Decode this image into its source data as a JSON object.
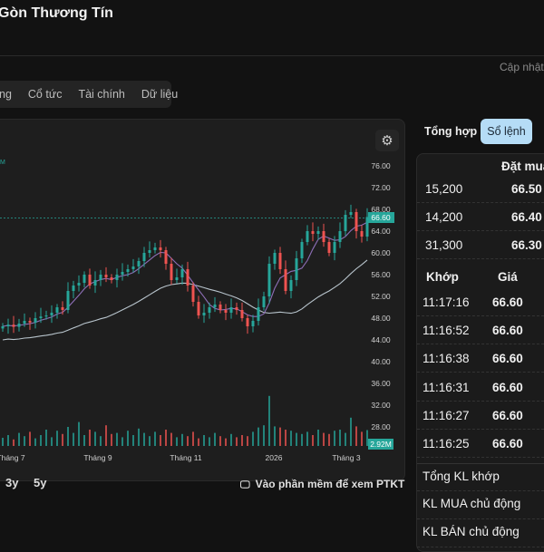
{
  "header": {
    "title": "Gòn Thương Tín",
    "updated": "Cập nhật"
  },
  "tabs": [
    "ng",
    "Cổ tức",
    "Tài chính",
    "Dữ liệu"
  ],
  "chart": {
    "legend_fragment": "M",
    "last_price_label": "66.60",
    "volume_label": "2.92M",
    "footer_link": "Vào phần mềm để xem PTKT",
    "ranges": [
      "3y",
      "5y"
    ]
  },
  "chart_data": {
    "type": "candlestick",
    "y_ticks": [
      "76.00",
      "72.00",
      "68.00",
      "64.00",
      "60.00",
      "56.00",
      "52.00",
      "48.00",
      "44.00",
      "40.00",
      "36.00",
      "32.00",
      "28.00"
    ],
    "x_ticks": [
      "Tháng 7",
      "Tháng 9",
      "Tháng 11",
      "2026",
      "Tháng 3"
    ],
    "ylim": [
      26,
      78
    ],
    "last_price": 66.6,
    "closes": [
      46.5,
      46.8,
      46.4,
      47,
      47.5,
      47.2,
      48,
      48.3,
      48.5,
      49,
      50,
      49.5,
      53,
      54,
      54.5,
      56,
      54,
      55,
      56,
      55.5,
      55,
      56,
      56.5,
      57,
      57.5,
      58.5,
      60,
      60.5,
      61,
      60.5,
      58,
      55,
      55.5,
      57,
      54,
      51,
      48.5,
      49,
      50,
      50.5,
      49.5,
      49,
      50,
      49.5,
      48,
      46.5,
      47.5,
      50,
      52,
      58,
      60,
      57,
      53,
      55,
      59,
      62,
      64,
      63.5,
      64,
      62,
      60,
      62,
      64,
      67,
      67.5,
      64,
      63,
      66.6
    ],
    "volumes_m": [
      1.5,
      2,
      1.2,
      2.4,
      1.8,
      2.6,
      1.4,
      2,
      3,
      1.6,
      2.8,
      2.2,
      3.5,
      2.4,
      4.4,
      2,
      3,
      2.6,
      1.8,
      3.8,
      2.2,
      2.4,
      1.6,
      2.8,
      2,
      3.2,
      2.4,
      1.8,
      2.6,
      2,
      3,
      2.4,
      1.6,
      2.2,
      1.8,
      2.6,
      1.4,
      2,
      1.6,
      2.4,
      1.8,
      1.4,
      2.2,
      1.6,
      2,
      1.8,
      2.6,
      3.4,
      3.8,
      9.2,
      3.6,
      3.4,
      3,
      2.8,
      2.4,
      2.2,
      2.6,
      2,
      3,
      2.4,
      2.2,
      2.8,
      3,
      2.4,
      5.2,
      3.6,
      2.6,
      2.92
    ],
    "up_color": "#26a69a",
    "down_color": "#ef5350"
  },
  "right": {
    "tabs": [
      "Tổng hợp",
      "Sổ lệnh"
    ],
    "bid_header": "Đặt mua",
    "bids": [
      {
        "vol": "15,200",
        "price": "66.50"
      },
      {
        "vol": "14,200",
        "price": "66.40"
      },
      {
        "vol": "31,300",
        "price": "66.30"
      }
    ],
    "trades_header": {
      "time": "Khớp",
      "price": "Giá"
    },
    "trades": [
      {
        "time": "11:17:16",
        "price": "66.60"
      },
      {
        "time": "11:16:52",
        "price": "66.60"
      },
      {
        "time": "11:16:38",
        "price": "66.60"
      },
      {
        "time": "11:16:31",
        "price": "66.60"
      },
      {
        "time": "11:16:27",
        "price": "66.60"
      },
      {
        "time": "11:16:25",
        "price": "66.60"
      }
    ],
    "summary": [
      "Tổng KL khớp",
      "KL MUA chủ động",
      "KL BÁN chủ động"
    ]
  },
  "colors": {
    "accent": "#b5dcf6",
    "green": "#1fae27",
    "teal": "#26a69a"
  }
}
